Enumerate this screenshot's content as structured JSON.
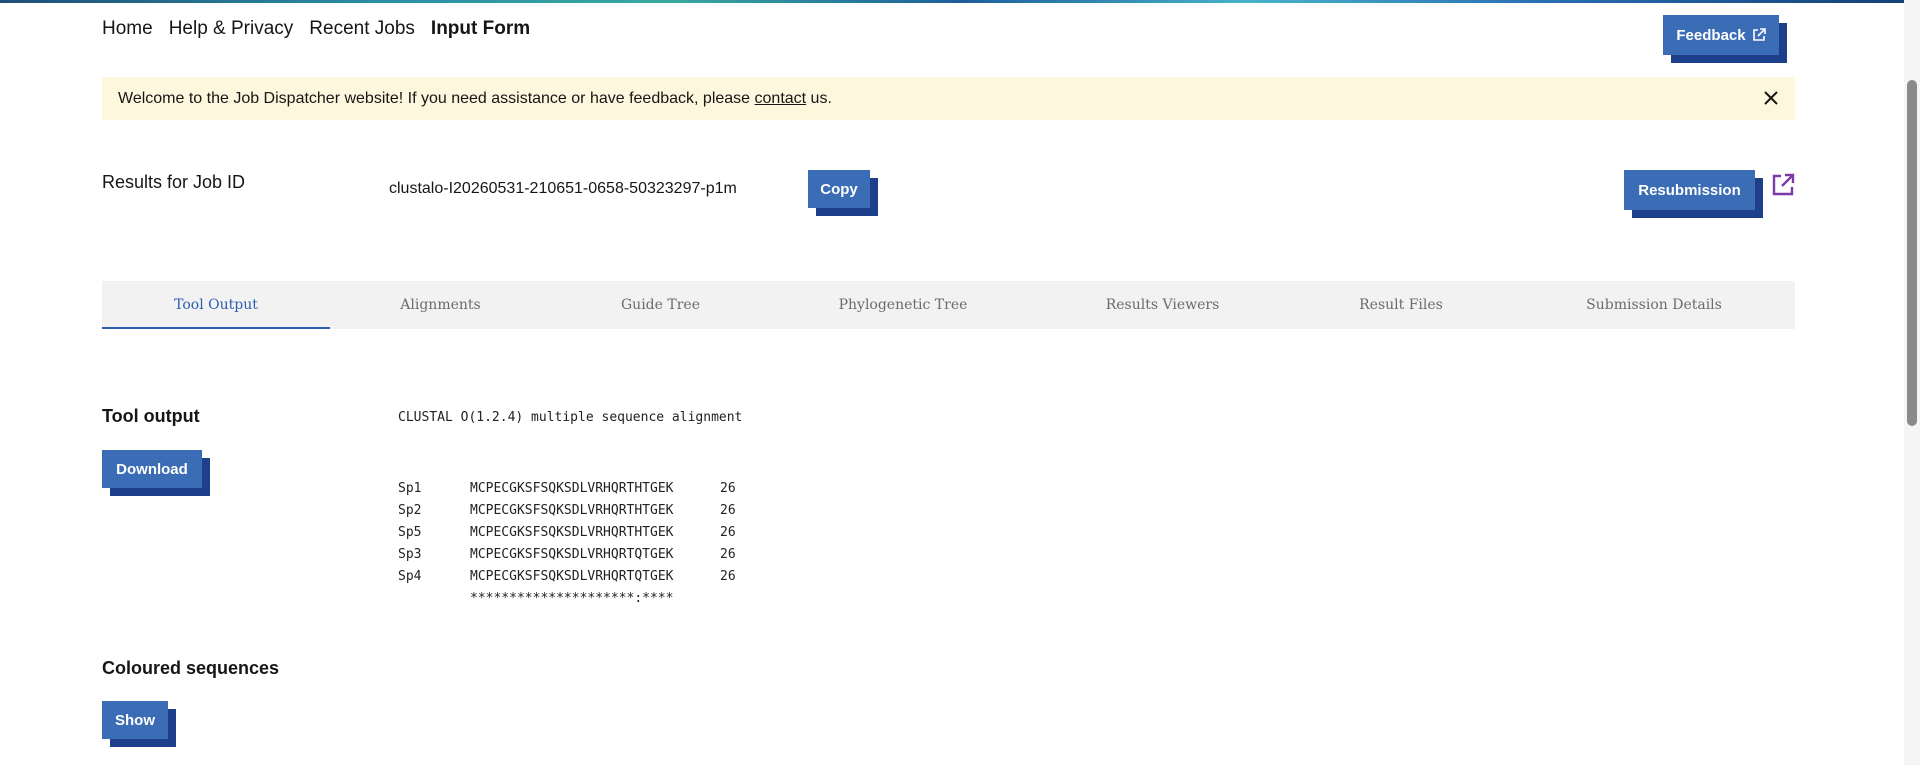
{
  "nav": {
    "items": [
      {
        "label": "Home"
      },
      {
        "label": "Help & Privacy"
      },
      {
        "label": "Recent Jobs"
      },
      {
        "label": "Input Form"
      }
    ]
  },
  "feedback_button": {
    "label": "Feedback"
  },
  "banner": {
    "text_before": "Welcome to the Job Dispatcher website! If you need assistance or have feedback, please ",
    "link_text": "contact",
    "text_after": " us."
  },
  "results": {
    "label": "Results for Job ID",
    "job_id": "clustalo-I20260531-210651-0658-50323297-p1m",
    "copy_label": "Copy",
    "resubmission_label": "Resubmission"
  },
  "tabs": [
    {
      "label": "Tool Output",
      "active": true
    },
    {
      "label": "Alignments",
      "active": false
    },
    {
      "label": "Guide Tree",
      "active": false
    },
    {
      "label": "Phylogenetic Tree",
      "active": false
    },
    {
      "label": "Results Viewers",
      "active": false
    },
    {
      "label": "Result Files",
      "active": false
    },
    {
      "label": "Submission Details",
      "active": false
    }
  ],
  "tool_output_section": {
    "title": "Tool output",
    "download_label": "Download",
    "header": "CLUSTAL O(1.2.4) multiple sequence alignment",
    "alignment": [
      {
        "name": "Sp1",
        "seq": "MCPECGKSFSQKSDLVRHQRTHTGEK",
        "count": "26"
      },
      {
        "name": "Sp2",
        "seq": "MCPECGKSFSQKSDLVRHQRTHTGEK",
        "count": "26"
      },
      {
        "name": "Sp5",
        "seq": "MCPECGKSFSQKSDLVRHQRTHTGEK",
        "count": "26"
      },
      {
        "name": "Sp3",
        "seq": "MCPECGKSFSQKSDLVRHQRTQTGEK",
        "count": "26"
      },
      {
        "name": "Sp4",
        "seq": "MCPECGKSFSQKSDLVRHQRTQTGEK",
        "count": "26"
      }
    ],
    "consensus": "*********************:****"
  },
  "coloured_section": {
    "title": "Coloured sequences",
    "show_label": "Show"
  },
  "colors": {
    "accent": "#3a6db5",
    "accent_shadow": "#1e3f8a",
    "banner_bg": "#fcf7dd",
    "tab_active": "#2c5fb0",
    "link_icon": "#7b3aa8"
  }
}
